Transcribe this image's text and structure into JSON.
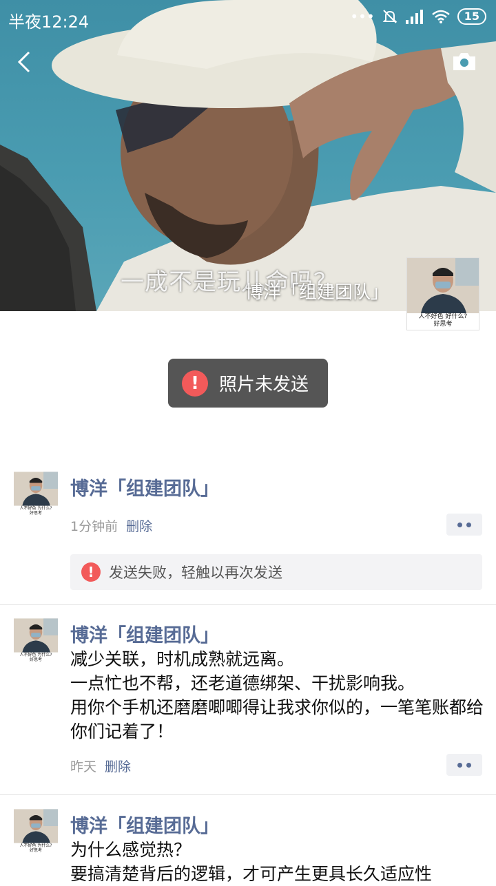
{
  "status_bar": {
    "time": "半夜12:24",
    "signal_dots": "•••",
    "battery": "15"
  },
  "cover": {
    "subtitle": "一成不是玩儿命吗？",
    "name": "博洋「组建团队」",
    "avatar_caption_1": "人不好色 好什么?",
    "avatar_caption_2": "好思考"
  },
  "toast": {
    "text": "照片未发送",
    "icon": "!"
  },
  "posts": [
    {
      "name": "博洋「组建团队」",
      "time": "1分钟前",
      "delete": "删除",
      "fail_text": "发送失败，轻触以再次发送",
      "fail_icon": "!",
      "avatar_caption_1": "人不好色 为什么?",
      "avatar_caption_2": "好思考"
    },
    {
      "name": "博洋「组建团队」",
      "lines": [
        "减少关联，时机成熟就远离。",
        "一点忙也不帮，还老道德绑架、干扰影响我。",
        "用你个手机还磨磨唧唧得让我求你似的，一笔笔账都给你们记着了！"
      ],
      "time": "昨天",
      "delete": "删除",
      "avatar_caption_1": "人不好色 为什么?",
      "avatar_caption_2": "好思考"
    },
    {
      "name": "博洋「组建团队」",
      "lines": [
        "为什么感觉热？",
        "要搞清楚背后的逻辑，才可产生更具长久适应性"
      ],
      "avatar_caption_1": "人不好色 为什么?",
      "avatar_caption_2": "好思考"
    }
  ],
  "colors": {
    "link": "#576b95",
    "error": "#f25a5a",
    "toast_bg": "#555555"
  },
  "icons": [
    "back-arrow-icon",
    "camera-icon",
    "mute-icon",
    "signal-icon",
    "wifi-icon",
    "battery-icon",
    "error-icon",
    "more-dots-icon"
  ]
}
